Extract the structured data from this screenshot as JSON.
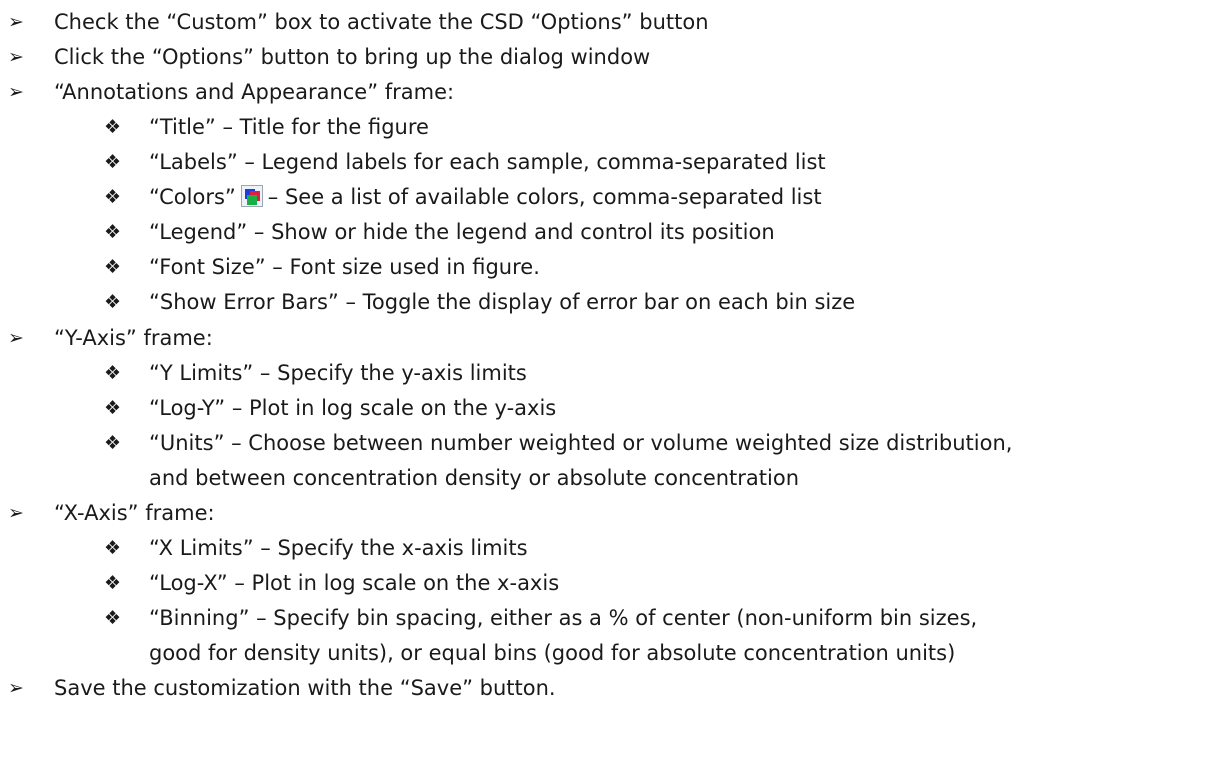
{
  "lines": [
    {
      "level": 1,
      "bullet": "➢",
      "text": "Check the “Custom” box to activate the CSD “Options” button"
    },
    {
      "level": 1,
      "bullet": "➢",
      "text": "Click the “Options” button to bring up the dialog window"
    },
    {
      "level": 1,
      "bullet": "➢",
      "text": "“Annotations and Appearance” frame:"
    },
    {
      "level": 2,
      "bullet": "❖",
      "text": "“Title” – Title for the figure"
    },
    {
      "level": 2,
      "bullet": "❖",
      "text": "“Labels” – Legend labels for each sample, comma-separated list"
    },
    {
      "level": 2,
      "bullet": "❖",
      "text_before": "“Colors”",
      "text_after": "– See a list of available colors, comma-separated list",
      "icon": "colors-palette-icon"
    },
    {
      "level": 2,
      "bullet": "❖",
      "text": "“Legend” – Show or hide the legend and control its position"
    },
    {
      "level": 2,
      "bullet": "❖",
      "text": "“Font Size” – Font size used in figure."
    },
    {
      "level": 2,
      "bullet": "❖",
      "text": "“Show Error Bars” – Toggle the display of error bar on each bin size"
    },
    {
      "level": 1,
      "bullet": "➢",
      "text": "“Y-Axis” frame:"
    },
    {
      "level": 2,
      "bullet": "❖",
      "text": "“Y Limits” – Specify the y-axis limits"
    },
    {
      "level": 2,
      "bullet": "❖",
      "text": "“Log-Y” – Plot in log scale on the y-axis"
    },
    {
      "level": 2,
      "bullet": "❖",
      "text": "“Units” – Choose between number weighted or volume weighted size distribution,"
    },
    {
      "level": 2,
      "bullet": "",
      "text": "and between concentration density or absolute concentration"
    },
    {
      "level": 1,
      "bullet": "➢",
      "text": "“X-Axis” frame:"
    },
    {
      "level": 2,
      "bullet": "❖",
      "text": "“X Limits” – Specify the x-axis limits"
    },
    {
      "level": 2,
      "bullet": "❖",
      "text": "“Log-X” – Plot in log scale on the x-axis"
    },
    {
      "level": 2,
      "bullet": "❖",
      "text": "“Binning” – Specify bin spacing, either as a % of center (non-uniform bin sizes,"
    },
    {
      "level": 2,
      "bullet": "",
      "text": "good for density units), or equal bins (good for absolute concentration units)"
    },
    {
      "level": 1,
      "bullet": "➢",
      "text": "Save the customization with the “Save” button."
    }
  ]
}
